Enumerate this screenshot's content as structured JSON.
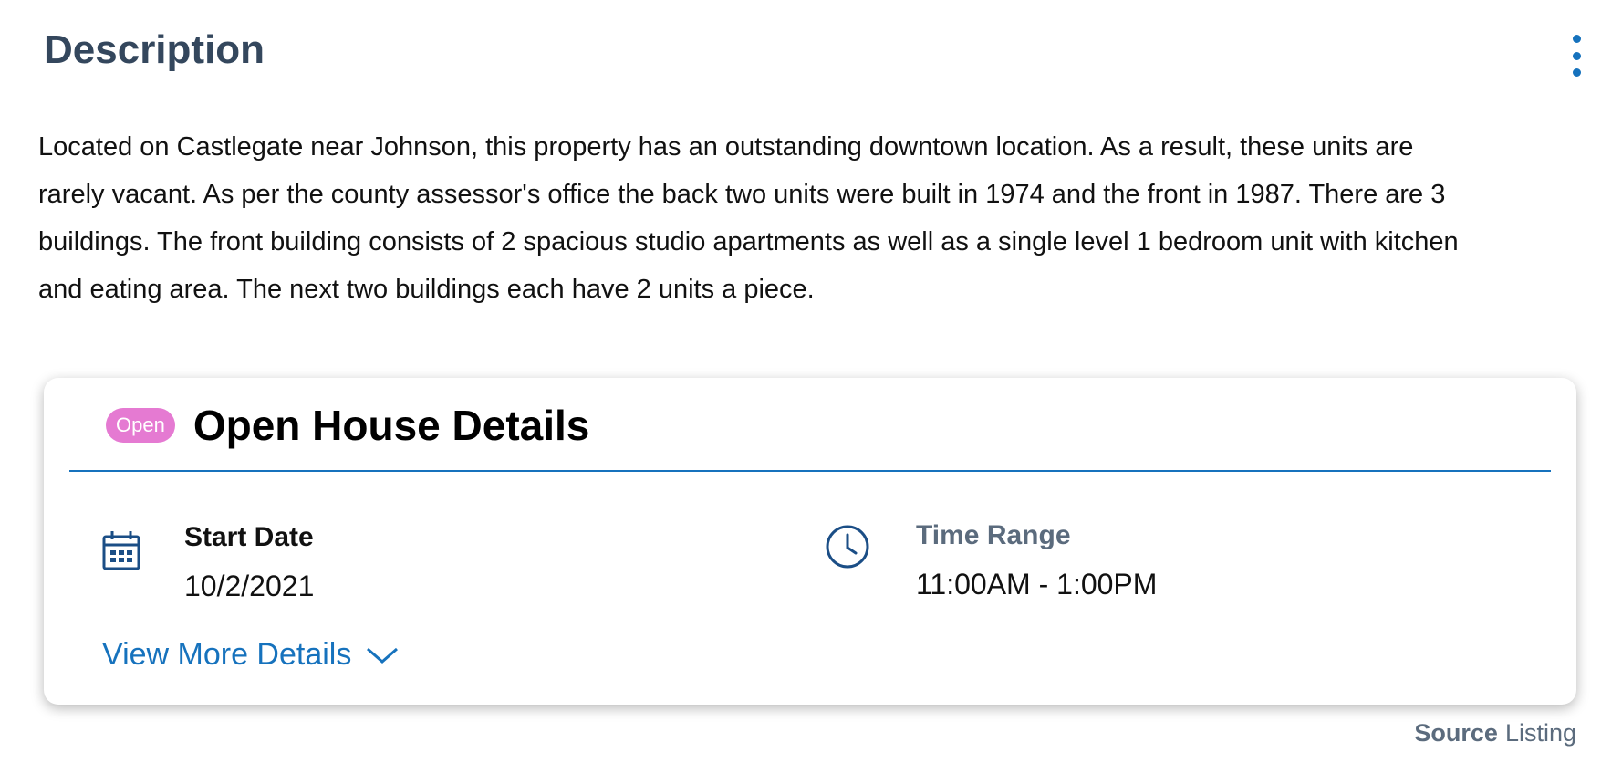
{
  "description": {
    "heading": "Description",
    "menu_icon": "more-vertical-icon",
    "body": "Located on Castlegate near Johnson, this property has an outstanding downtown location. As a result, these units are rarely vacant. As per the county assessor's office the back two units were built in 1974 and the front in 1987. There are 3 buildings. The front building consists of 2 spacious studio apartments as well as a single level 1 bedroom unit with kitchen and eating area. The next two buildings each have 2 units a piece."
  },
  "open_house": {
    "badge": "Open",
    "title": "Open House Details",
    "start": {
      "icon": "calendar-icon",
      "label": "Start Date",
      "value": "10/2/2021"
    },
    "time": {
      "icon": "clock-icon",
      "label": "Time Range",
      "value": "11:00AM - 1:00PM"
    },
    "view_more_label": "View More Details",
    "view_more_icon": "chevron-down-icon"
  },
  "source": {
    "label": "Source",
    "value": "Listing"
  },
  "colors": {
    "accent": "#1672bd",
    "heading": "#34475d",
    "badge": "#e57ad2",
    "muted": "#5b6b7d"
  }
}
